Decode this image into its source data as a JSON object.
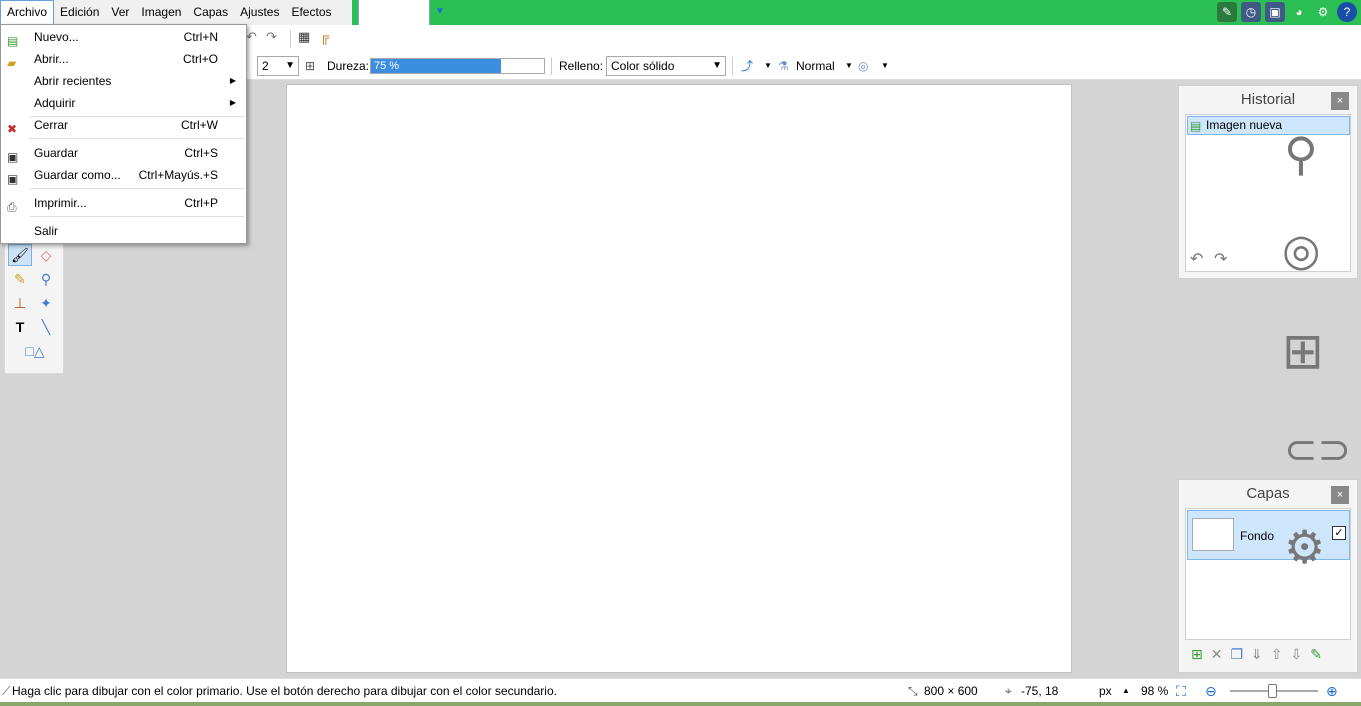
{
  "menubar": {
    "items": [
      "Archivo",
      "Edición",
      "Ver",
      "Imagen",
      "Capas",
      "Ajustes",
      "Efectos"
    ],
    "active": "Archivo"
  },
  "file_menu": {
    "items": [
      {
        "label": "Nuevo...",
        "shortcut": "Ctrl+N",
        "icon": "new-image-icon"
      },
      {
        "label": "Abrir...",
        "shortcut": "Ctrl+O",
        "icon": "open-folder-icon"
      },
      {
        "label": "Abrir recientes",
        "shortcut": "",
        "submenu": true
      },
      {
        "label": "Adquirir",
        "shortcut": "",
        "submenu": true
      },
      {
        "label": "Cerrar",
        "shortcut": "Ctrl+W",
        "icon": "close-file-icon"
      },
      {
        "label": "Guardar",
        "shortcut": "Ctrl+S",
        "icon": "save-icon"
      },
      {
        "label": "Guardar como...",
        "shortcut": "Ctrl+Mayús.+S",
        "icon": "save-as-icon"
      },
      {
        "label": "Imprimir...",
        "shortcut": "Ctrl+P",
        "icon": "print-icon"
      },
      {
        "label": "Salir",
        "shortcut": ""
      }
    ]
  },
  "toolbar": {
    "brush_width": "2",
    "hardness_label": "Dureza:",
    "hardness_value": "75 %",
    "hardness_fraction": 0.75,
    "fill_label": "Relleno:",
    "fill_value": "Color sólido",
    "blend_mode": "Normal"
  },
  "history_panel": {
    "title": "Historial",
    "items": [
      "Imagen nueva"
    ]
  },
  "layers_panel": {
    "title": "Capas",
    "layers": [
      {
        "name": "Fondo",
        "visible": true
      }
    ]
  },
  "status": {
    "hint": "Haga clic para dibujar con el color primario. Use el botón derecho para dibujar con el color secundario.",
    "image_size": "800 × 600",
    "cursor": "-75, 18",
    "units": "px",
    "zoom": "98 %"
  },
  "colors": {
    "accent_green": "#2bbf54",
    "selection_blue": "#cde6fb",
    "slider_blue": "#3c8fe0"
  },
  "close_glyph": "×"
}
